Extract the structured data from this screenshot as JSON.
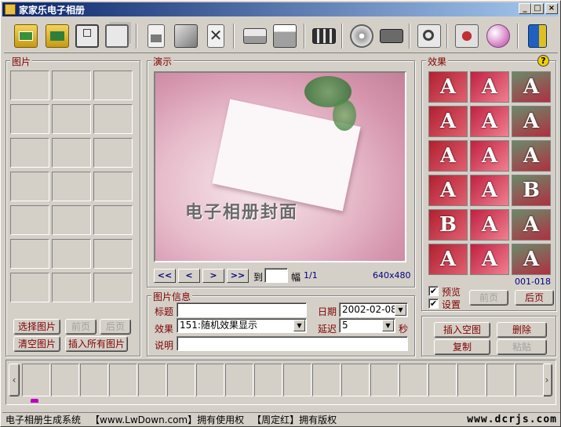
{
  "window": {
    "title": "家家乐电子相册"
  },
  "toolbar": {
    "icons": [
      "open-album-icon",
      "open-folder-icon",
      "save-icon",
      "save-as-icon",
      "new-page-icon",
      "export-icon",
      "delete-icon",
      "scanner-icon",
      "printer-icon",
      "filmstrip-icon",
      "music-cd-icon",
      "video-camera-icon",
      "photo-preview-icon",
      "settings-icon",
      "web-globe-icon",
      "exit-door-icon"
    ]
  },
  "pictures": {
    "label": "图片",
    "select_btn": "选择图片",
    "prev_btn": "前页",
    "next_btn": "后页",
    "clear_btn": "清空图片",
    "insert_all_btn": "插入所有图片"
  },
  "demo": {
    "label": "演示",
    "caption": "电子相册封面",
    "nav_first": "<<",
    "nav_prev": "<",
    "nav_next": ">",
    "nav_last": ">>",
    "goto_label": "到",
    "goto_value": "",
    "page_label": "幅",
    "page_value": "1/1",
    "resolution": "640x480"
  },
  "info": {
    "label": "图片信息",
    "title_label": "标题",
    "title_value": "",
    "date_label": "日期",
    "date_value": "2002-02-08",
    "effect_label": "效果",
    "effect_value": "151:随机效果显示",
    "delay_label": "延迟",
    "delay_value": "5",
    "delay_unit": "秒",
    "desc_label": "说明",
    "desc_value": ""
  },
  "effects": {
    "label": "效果",
    "help": "?",
    "range": "001-018",
    "preview_label": "预览",
    "settings_label": "设置",
    "preview_checked": "✔",
    "settings_checked": "✔",
    "prev_btn": "前页",
    "next_btn": "后页",
    "tiles": [
      "A",
      "A",
      "A",
      "A",
      "A",
      "A",
      "A",
      "A",
      "A",
      "A",
      "A",
      "B",
      "B",
      "A",
      "A",
      "A",
      "A",
      "A"
    ]
  },
  "actions": {
    "insert_blank": "插入空图",
    "delete": "删除",
    "copy": "复制",
    "paste": "粘贴"
  },
  "filmstrip": {
    "left_arrow": "‹",
    "right_arrow": "›"
  },
  "statusbar": {
    "app_text": "电子相册生成系统",
    "owner_text": "【www.LwDown.com】拥有使用权",
    "copyright_text": "【周定红】拥有版权",
    "watermark": "www.dcrjs.com"
  }
}
